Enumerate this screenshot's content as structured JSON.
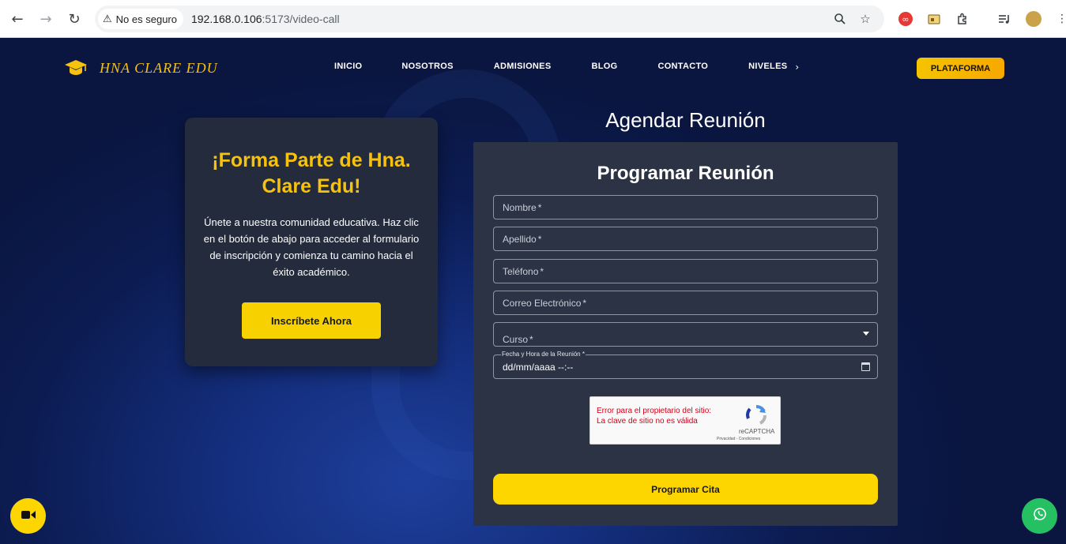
{
  "browser": {
    "security_label": "No es seguro",
    "url_host": "192.168.0.106",
    "url_port_path": ":5173/video-call"
  },
  "header": {
    "brand": "HNA CLARE EDU",
    "menu": [
      "INICIO",
      "NOSOTROS",
      "ADMISIONES",
      "BLOG",
      "CONTACTO",
      "NIVELES"
    ],
    "cta": "PLATAFORMA"
  },
  "join_card": {
    "title": "¡Forma Parte de Hna. Clare Edu!",
    "text": "Únete a nuestra comunidad educativa. Haz clic en el botón de abajo para acceder al formulario de inscripción y comienza tu camino hacia el éxito académico.",
    "button": "Inscríbete Ahora"
  },
  "meeting": {
    "page_title": "Agendar Reunión",
    "form_title": "Programar Reunión",
    "fields": {
      "nombre": "Nombre",
      "apellido": "Apellido",
      "telefono": "Teléfono",
      "correo": "Correo Electrónico",
      "curso": "Curso",
      "fecha_label": "Fecha y Hora de la Reunión",
      "fecha_value": "dd/mm/aaaa  --:--"
    },
    "required_mark": "*",
    "captcha": {
      "error": "Error para el propietario del sitio: La clave de sitio no es válida",
      "brand": "reCAPTCHA",
      "links": "Privacidad - Condiciones"
    },
    "submit": "Programar Cita"
  },
  "colors": {
    "accent": "#fdd600",
    "brand_gold": "#f7c20d",
    "card_bg": "#232b3d",
    "form_bg": "#2b3345",
    "whatsapp": "#25c062"
  },
  "icons": [
    "back-icon",
    "forward-icon",
    "reload-icon",
    "warning-icon",
    "zoom-icon",
    "star-icon",
    "extensions-icon",
    "media-icon",
    "menu-icon",
    "graduation-cap-icon",
    "chevron-right-icon",
    "dropdown-caret-icon",
    "calendar-icon",
    "recaptcha-icon",
    "video-camera-icon",
    "whatsapp-icon"
  ]
}
